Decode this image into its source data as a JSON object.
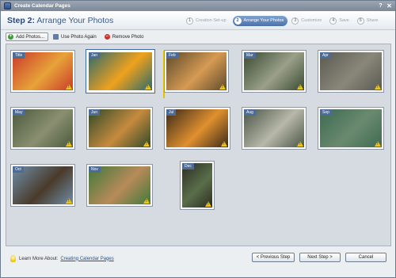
{
  "window": {
    "title": "Create Calendar Pages"
  },
  "header": {
    "step_label": "Step 2:",
    "step_title": "Arrange Your Photos"
  },
  "wizard": [
    {
      "num": "1",
      "label": "Creation Set-up"
    },
    {
      "num": "2",
      "label": "Arrange Your Photos"
    },
    {
      "num": "3",
      "label": "Customize"
    },
    {
      "num": "4",
      "label": "Save"
    },
    {
      "num": "5",
      "label": "Share"
    }
  ],
  "toolbar": {
    "add_photos": "Add Photos...",
    "use_again": "Use Photo Again",
    "remove": "Remove Photo"
  },
  "photos": [
    {
      "month": "Title",
      "colors": [
        "#c93a2a",
        "#e8a33a"
      ]
    },
    {
      "month": "Jan",
      "colors": [
        "#2b6a6e",
        "#f0a11c"
      ]
    },
    {
      "month": "Feb",
      "colors": [
        "#5d4a2e",
        "#d69a52"
      ]
    },
    {
      "month": "Mar",
      "colors": [
        "#3a4a32",
        "#9aa08a"
      ]
    },
    {
      "month": "Apr",
      "colors": [
        "#5a5a52",
        "#8a877a"
      ]
    },
    {
      "month": "May",
      "colors": [
        "#4b5a3e",
        "#8a8f70"
      ]
    },
    {
      "month": "Jun",
      "colors": [
        "#2f4a2a",
        "#c68a3e"
      ]
    },
    {
      "month": "Jul",
      "colors": [
        "#3a2a1a",
        "#e0902e"
      ]
    },
    {
      "month": "Aug",
      "colors": [
        "#4a5646",
        "#b8b8aa"
      ]
    },
    {
      "month": "Sep",
      "colors": [
        "#3e6a52",
        "#6a8a6e"
      ]
    },
    {
      "month": "Oct",
      "colors": [
        "#6e8ea8",
        "#4a3a2a"
      ]
    },
    {
      "month": "Nov",
      "colors": [
        "#3f7a3a",
        "#b88a5a"
      ]
    },
    {
      "month": "Dec",
      "colors": [
        "#2a2c22",
        "#5a6e4a"
      ]
    }
  ],
  "footer": {
    "learn_more": "Learn More About:",
    "learn_link": "Creating Calendar Pages",
    "prev": "< Previous Step",
    "next": "Next Step >",
    "cancel": "Cancel"
  }
}
